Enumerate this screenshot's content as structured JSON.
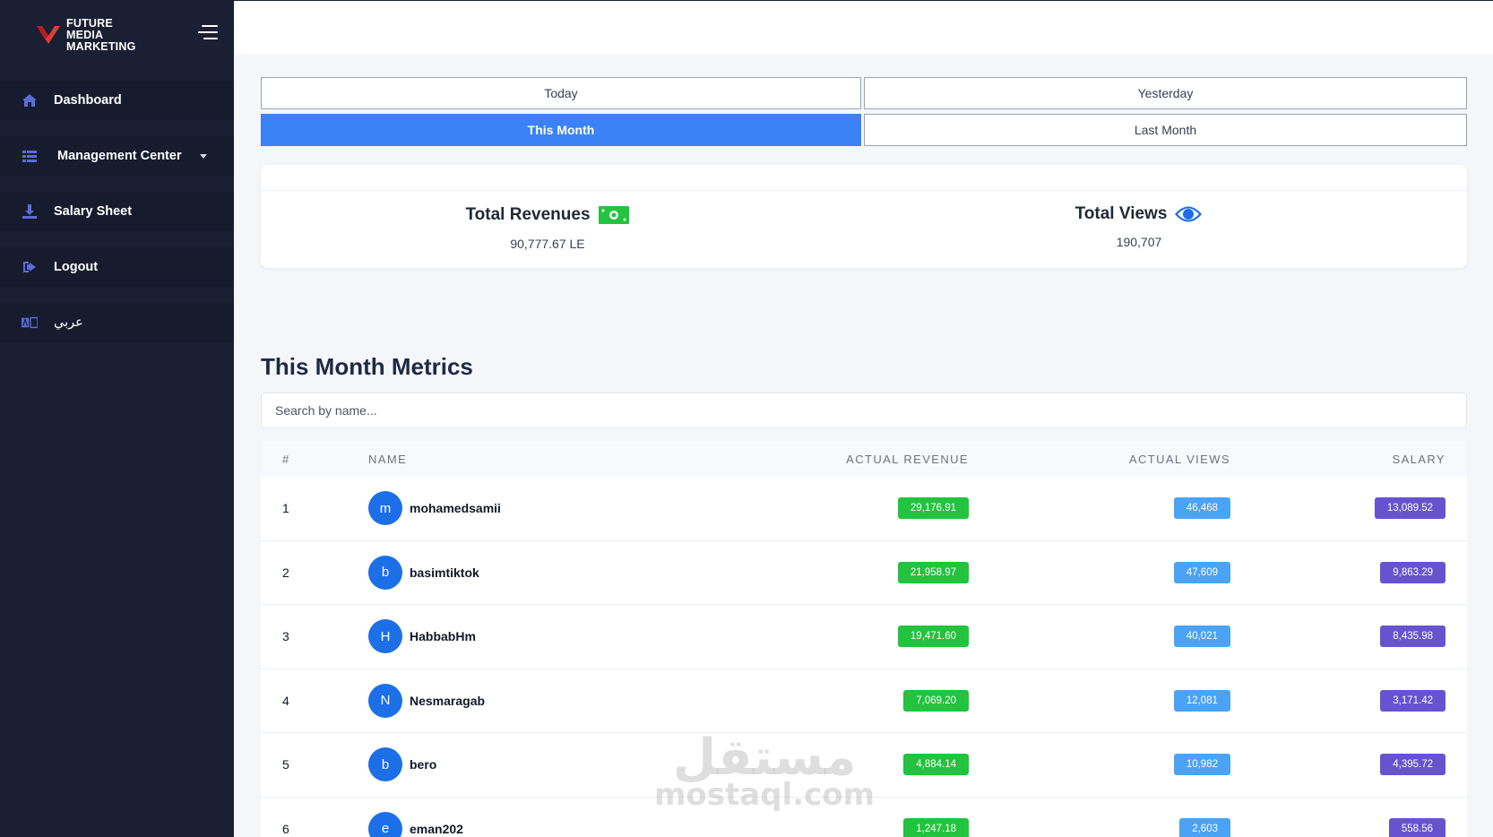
{
  "brand": {
    "line1": "FUTURE",
    "line2": "MEDIA",
    "line3": "MARKETING",
    "logo_color": "#e53935"
  },
  "sidebar": {
    "items": [
      {
        "label": "Dashboard",
        "icon": "home-icon"
      },
      {
        "label": "Management Center",
        "icon": "list-icon"
      },
      {
        "label": "Salary Sheet",
        "icon": "download-icon"
      },
      {
        "label": "Logout",
        "icon": "logout-icon"
      },
      {
        "label": "عربي",
        "icon": "language-icon"
      }
    ]
  },
  "filters": {
    "today": "Today",
    "yesterday": "Yesterday",
    "this_month": "This Month",
    "last_month": "Last Month",
    "active": "This Month"
  },
  "summary": {
    "revenues_label": "Total Revenues",
    "revenues_value": "90,777.67 LE",
    "views_label": "Total Views",
    "views_value": "190,707"
  },
  "metrics": {
    "title": "This Month Metrics",
    "search_placeholder": "Search by name...",
    "columns": [
      "#",
      "NAME",
      "ACTUAL REVENUE",
      "ACTUAL VIEWS",
      "SALARY"
    ],
    "rows": [
      {
        "num": "1",
        "initial": "m",
        "name": "mohamedsamii",
        "revenue": "29,176.91",
        "views": "46,468",
        "salary": "13,089.52"
      },
      {
        "num": "2",
        "initial": "b",
        "name": "basimtiktok",
        "revenue": "21,958.97",
        "views": "47,609",
        "salary": "9,863.29"
      },
      {
        "num": "3",
        "initial": "H",
        "name": "HabbabHm",
        "revenue": "19,471.60",
        "views": "40,021",
        "salary": "8,435.98"
      },
      {
        "num": "4",
        "initial": "N",
        "name": "Nesmaragab",
        "revenue": "7,069.20",
        "views": "12,081",
        "salary": "3,171.42"
      },
      {
        "num": "5",
        "initial": "b",
        "name": "bero",
        "revenue": "4,884.14",
        "views": "10,982",
        "salary": "4,395.72"
      },
      {
        "num": "6",
        "initial": "e",
        "name": "eman202",
        "revenue": "1,247.18",
        "views": "2,603",
        "salary": "558.56"
      }
    ]
  },
  "watermark": {
    "arabic": "مستقل",
    "latin": "mostaql.com"
  },
  "colors": {
    "accent": "#3b82f6",
    "sidebar": "#1a1f33",
    "revenue": "#22c33e",
    "views": "#4aa3f5",
    "salary": "#6753cf"
  }
}
